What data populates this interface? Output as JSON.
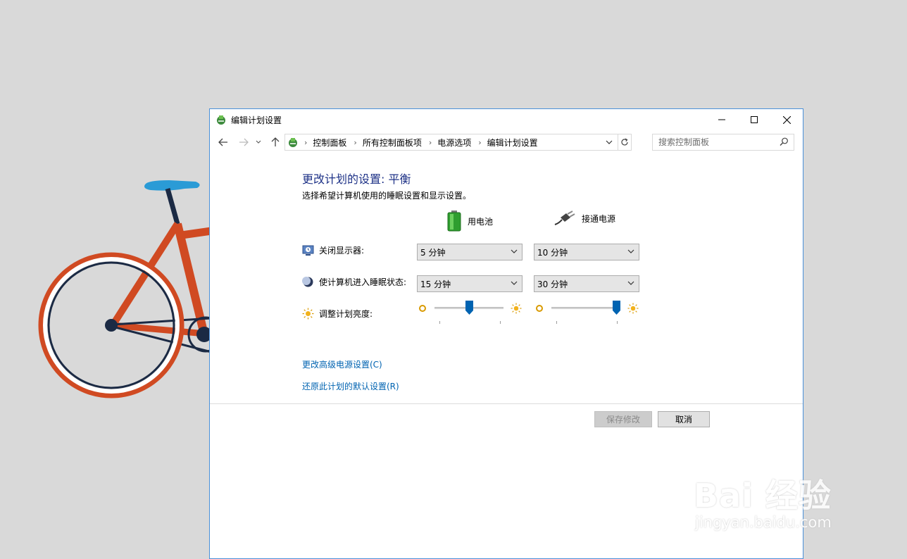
{
  "window": {
    "title": "编辑计划设置"
  },
  "address": {
    "crumbs": [
      "控制面板",
      "所有控制面板项",
      "电源选项",
      "编辑计划设置"
    ]
  },
  "search": {
    "placeholder": "搜索控制面板"
  },
  "page": {
    "heading": "更改计划的设置: 平衡",
    "subtext": "选择希望计算机使用的睡眠设置和显示设置。"
  },
  "columns": {
    "battery": "用电池",
    "plugged": "接通电源"
  },
  "settings": {
    "display_off": {
      "label": "关闭显示器:",
      "battery": "5 分钟",
      "plugged": "10 分钟"
    },
    "sleep": {
      "label": "使计算机进入睡眠状态:",
      "battery": "15 分钟",
      "plugged": "30 分钟"
    },
    "brightness": {
      "label": "调整计划亮度:",
      "battery_level": 0.5,
      "plugged_level": 1.0
    }
  },
  "links": {
    "advanced": "更改高级电源设置(C)",
    "restore": "还原此计划的默认设置(R)"
  },
  "buttons": {
    "save": "保存修改",
    "cancel": "取消"
  },
  "watermark": {
    "brand": "Bai 经验",
    "url": "jingyan.baidu.com"
  },
  "colors": {
    "accent": "#0063b1",
    "heading": "#1e3287",
    "bike": "#d04a22"
  }
}
